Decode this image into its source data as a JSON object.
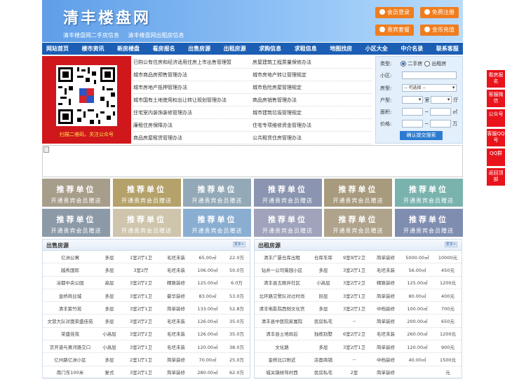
{
  "header": {
    "logo": "清丰楼盘网",
    "sub_links": [
      "清丰楼盘网二手房信息",
      "清丰楼盘网出租房信息"
    ],
    "buttons": [
      "会员登录",
      "免费注册",
      "贵宾套餐",
      "金币充值"
    ]
  },
  "nav": [
    "网站首页",
    "楼市资讯",
    "新房楼盘",
    "看房报名",
    "出售房源",
    "出租房源",
    "求购信息",
    "求租信息",
    "地图找房",
    "小区大全",
    "中介名录",
    "联系客服"
  ],
  "qr_caption": "扫描二维码，关注公众号",
  "news_links": [
    [
      "已购公有住房和经济适用住房上市出售管理暂",
      "房屋建筑工程质量保修办法"
    ],
    [
      "城市商品房预售管理办法",
      "城市房地产转让管理规定"
    ],
    [
      "城市房地产抵押管理办法",
      "城市危险房屋管理规定"
    ],
    [
      "城市国有土地使用权出让转让规划管理办法",
      "商品房销售管理办法"
    ],
    [
      "住宅室内装饰装修管理办法",
      "城市建筑垃圾管理规定"
    ],
    [
      "廉租住房保障办法",
      "住宅专项维修资金管理办法"
    ],
    [
      "商品房屋租赁管理办法",
      "公共租赁住房管理办法"
    ]
  ],
  "search": {
    "type_label": "类型:",
    "type_options": [
      "二手房",
      "出租房"
    ],
    "community_label": "小区:",
    "house_type_label": "房型:",
    "house_type_value": "-- 可选择 --",
    "layout_label": "户型:",
    "room_unit": "室",
    "hall_unit": "厅",
    "area_label": "面积:",
    "area_unit": "㎡",
    "price_label": "价格:",
    "price_unit": "万",
    "range_sep": "~",
    "submit": "确认提交搜索"
  },
  "ad_tiles": {
    "title": "推荐单位",
    "subtitle": "开通贵宾会员赠送",
    "colors": [
      "#a79d8b",
      "#b5a26a",
      "#93a9b7",
      "#8b95b1",
      "#a89a7d",
      "#7ab3ae",
      "#8c9aa8",
      "#cfc5ac",
      "#8aaed2",
      "#9fa3bb",
      "#b0a38c",
      "#7f8db0"
    ]
  },
  "sale": {
    "title": "出售房源",
    "more": "更多>",
    "rows": [
      [
        "亿洲公寓",
        "多层",
        "1室2厅1卫",
        "毛坯未装",
        "65.00㎡",
        "22.0万"
      ],
      [
        "越秀国际",
        "多层",
        "3室2厅",
        "毛坯未装",
        "106.00㎡",
        "50.0万"
      ],
      [
        "冶都中央公园",
        "高层",
        "3室2厅2卫",
        "精致装修",
        "125.00㎡",
        "6.0万"
      ],
      [
        "金桥商业城",
        "多层",
        "3室2厅1卫",
        "豪华装修",
        "83.00㎡",
        "53.0万"
      ],
      [
        "清丰紫竹苑",
        "多层",
        "3室2厅1卫",
        "简单装修",
        "133.00㎡",
        "52.8万"
      ],
      [
        "文营大队对面荣盛佳苑",
        "多层",
        "3室2厅2卫",
        "毛坯未装",
        "126.00㎡",
        "35.0万"
      ],
      [
        "荣盛佳苑",
        "小高层",
        "3室2厅2卫",
        "毛坯未装",
        "126.00㎡",
        "35.0万"
      ],
      [
        "京开道与黄河路交口",
        "小高层",
        "3室2厅1卫",
        "毛坯未装",
        "120.00㎡",
        "38.0万"
      ],
      [
        "亿州路亿洲小区",
        "多层",
        "2室1厅1卫",
        "简单装修",
        "70.00㎡",
        "25.0万"
      ],
      [
        "南门东100米",
        "复式",
        "3室2厅1卫",
        "简单装修",
        "280.00㎡",
        "62.0万"
      ]
    ]
  },
  "rent": {
    "title": "出租房源",
    "more": "更多>",
    "rows": [
      [
        "清丰广厦仓库出租",
        "仓库车库",
        "9室9厅2卫",
        "简单装修",
        "5000.00㎡",
        "10000元"
      ],
      [
        "钻井一公司菊园小区",
        "多层",
        "3室2厅1卫",
        "毛坯未装",
        "56.00㎡",
        "450元"
      ],
      [
        "清丰县五眼井社区",
        "小高层",
        "3室2厅2卫",
        "精致装修",
        "125.00㎡",
        "1200元"
      ],
      [
        "北环路交警队对过时尚",
        "跃层",
        "3室2厅1卫",
        "简单装修",
        "80.00㎡",
        "400元"
      ],
      [
        "清丰电影院西侧文化宫",
        "多层",
        "3室2厅1卫",
        "中档装修",
        "100.00㎡",
        "700元"
      ],
      [
        "清丰县中医院家属院",
        "民房私宅",
        "--",
        "简单装修",
        "200.00㎡",
        "650元"
      ],
      [
        "清丰县土地局后",
        "独栋别墅",
        "6室2厅2卫",
        "毛坯未装",
        "260.00㎡",
        "1200元"
      ],
      [
        "文化路",
        "多层",
        "3室2厅1卫",
        "简单装修",
        "120.00㎡",
        "900元"
      ],
      [
        "金桥北口附近",
        "店面商铺",
        "--",
        "中档装修",
        "40.00㎡",
        "1500元"
      ],
      [
        "城关镇候驾村西",
        "民房私宅",
        "2室",
        "简单装修",
        "",
        "元"
      ]
    ]
  },
  "float_tabs": [
    "看房报名",
    "客服微信",
    "公众号",
    "客服QQ号",
    "QQ群",
    "返回顶部"
  ]
}
